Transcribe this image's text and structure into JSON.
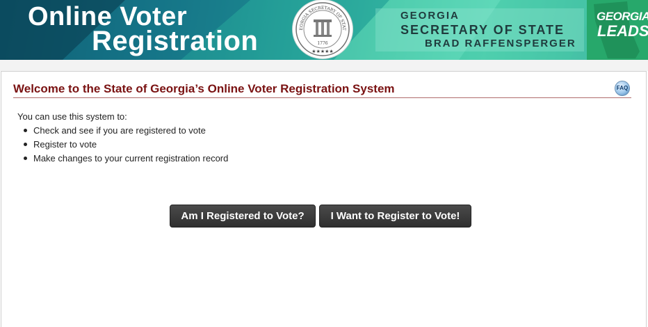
{
  "banner": {
    "title_line1": "Online Voter",
    "title_line2": "Registration",
    "seal_icon": "georgia-secretary-of-state-seal-icon",
    "seal_text_top": "GEORGIA SECRETARY OF STATE",
    "seal_text_center": "STATE OF GEORGIA",
    "seal_year": "1776",
    "sos_line1": "GEORGIA",
    "sos_line2": "SECRETARY OF STATE",
    "sos_line3": "BRAD RAFFENSPERGER",
    "leads_line1": "GEORGIA",
    "leads_line2": "LEADS"
  },
  "main": {
    "heading": "Welcome to the State of Georgia’s Online Voter Registration System",
    "faq_label": "FAQ",
    "intro": "You can use this system to:",
    "bullets": [
      "Check and see if you are registered to vote",
      "Register to vote",
      "Make changes to your current registration record"
    ],
    "buttons": {
      "check": "Am I Registered to Vote?",
      "register": "I Want to Register to Vote!"
    }
  },
  "colors": {
    "heading": "#7a1212",
    "button_bg": "#333333",
    "banner_teal": "#2aa79a",
    "leads_green": "#27a86b"
  }
}
